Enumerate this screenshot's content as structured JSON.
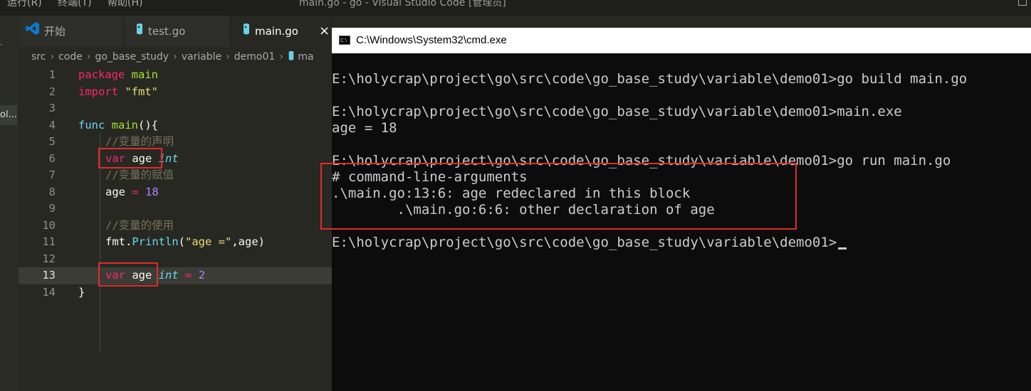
{
  "window": {
    "title": "main.go - go - Visual Studio Code [管理员]",
    "menu": [
      "运行(R)",
      "终端(T)",
      "帮助(H)"
    ]
  },
  "sidebar": {
    "fragment": "ol..."
  },
  "tabs": [
    {
      "label": "开始",
      "icon": "vscode-logo-icon"
    },
    {
      "label": "test.go",
      "icon": "go-file-icon"
    },
    {
      "label": "main.go",
      "icon": "go-file-icon",
      "active": true,
      "close": "×"
    }
  ],
  "breadcrumb": [
    "src",
    "code",
    "go_base_study",
    "variable",
    "demo01",
    "ma"
  ],
  "editor": {
    "line_numbers": [
      "1",
      "2",
      "3",
      "4",
      "5",
      "6",
      "7",
      "8",
      "9",
      "10",
      "11",
      "12",
      "13",
      "14"
    ],
    "current_line": 13,
    "tokens": {
      "l1_kw": "package",
      "l1_name": "main",
      "l2_kw": "import",
      "l2_str": "\"fmt\"",
      "l4_kw": "func",
      "l4_fn": "main",
      "l4_rest": "(){",
      "l5_cm": "//变量的声明",
      "l6_kw": "var",
      "l6_id": "age",
      "l6_ty": "int",
      "l7_cm": "//变量的赋值",
      "l8_id": "age",
      "l8_op": "=",
      "l8_num": "18",
      "l10_cm": "//变量的使用",
      "l11_pkg": "fmt.",
      "l11_fn": "Println",
      "l11_p1": "(",
      "l11_str": "\"age =\"",
      "l11_rest": ",age)",
      "l13_kw": "var",
      "l13_id": "age",
      "l13_ty": "int",
      "l13_op": "=",
      "l13_num": "2",
      "l14": "}"
    }
  },
  "cmd": {
    "title": "C:\\Windows\\System32\\cmd.exe",
    "lines": [
      "E:\\holycrap\\project\\go\\src\\code\\go_base_study\\variable\\demo01>go build main.go",
      "E:\\holycrap\\project\\go\\src\\code\\go_base_study\\variable\\demo01>main.exe",
      "age = 18",
      "E:\\holycrap\\project\\go\\src\\code\\go_base_study\\variable\\demo01>go run main.go",
      "# command-line-arguments",
      ".\\main.go:13:6: age redeclared in this block",
      "        .\\main.go:6:6: other declaration of age",
      "E:\\holycrap\\project\\go\\src\\code\\go_base_study\\variable\\demo01>"
    ]
  },
  "colors": {
    "highlight_box": "#e12b2b",
    "editor_bg": "#272822",
    "cmd_bg": "#0c0c0c"
  }
}
